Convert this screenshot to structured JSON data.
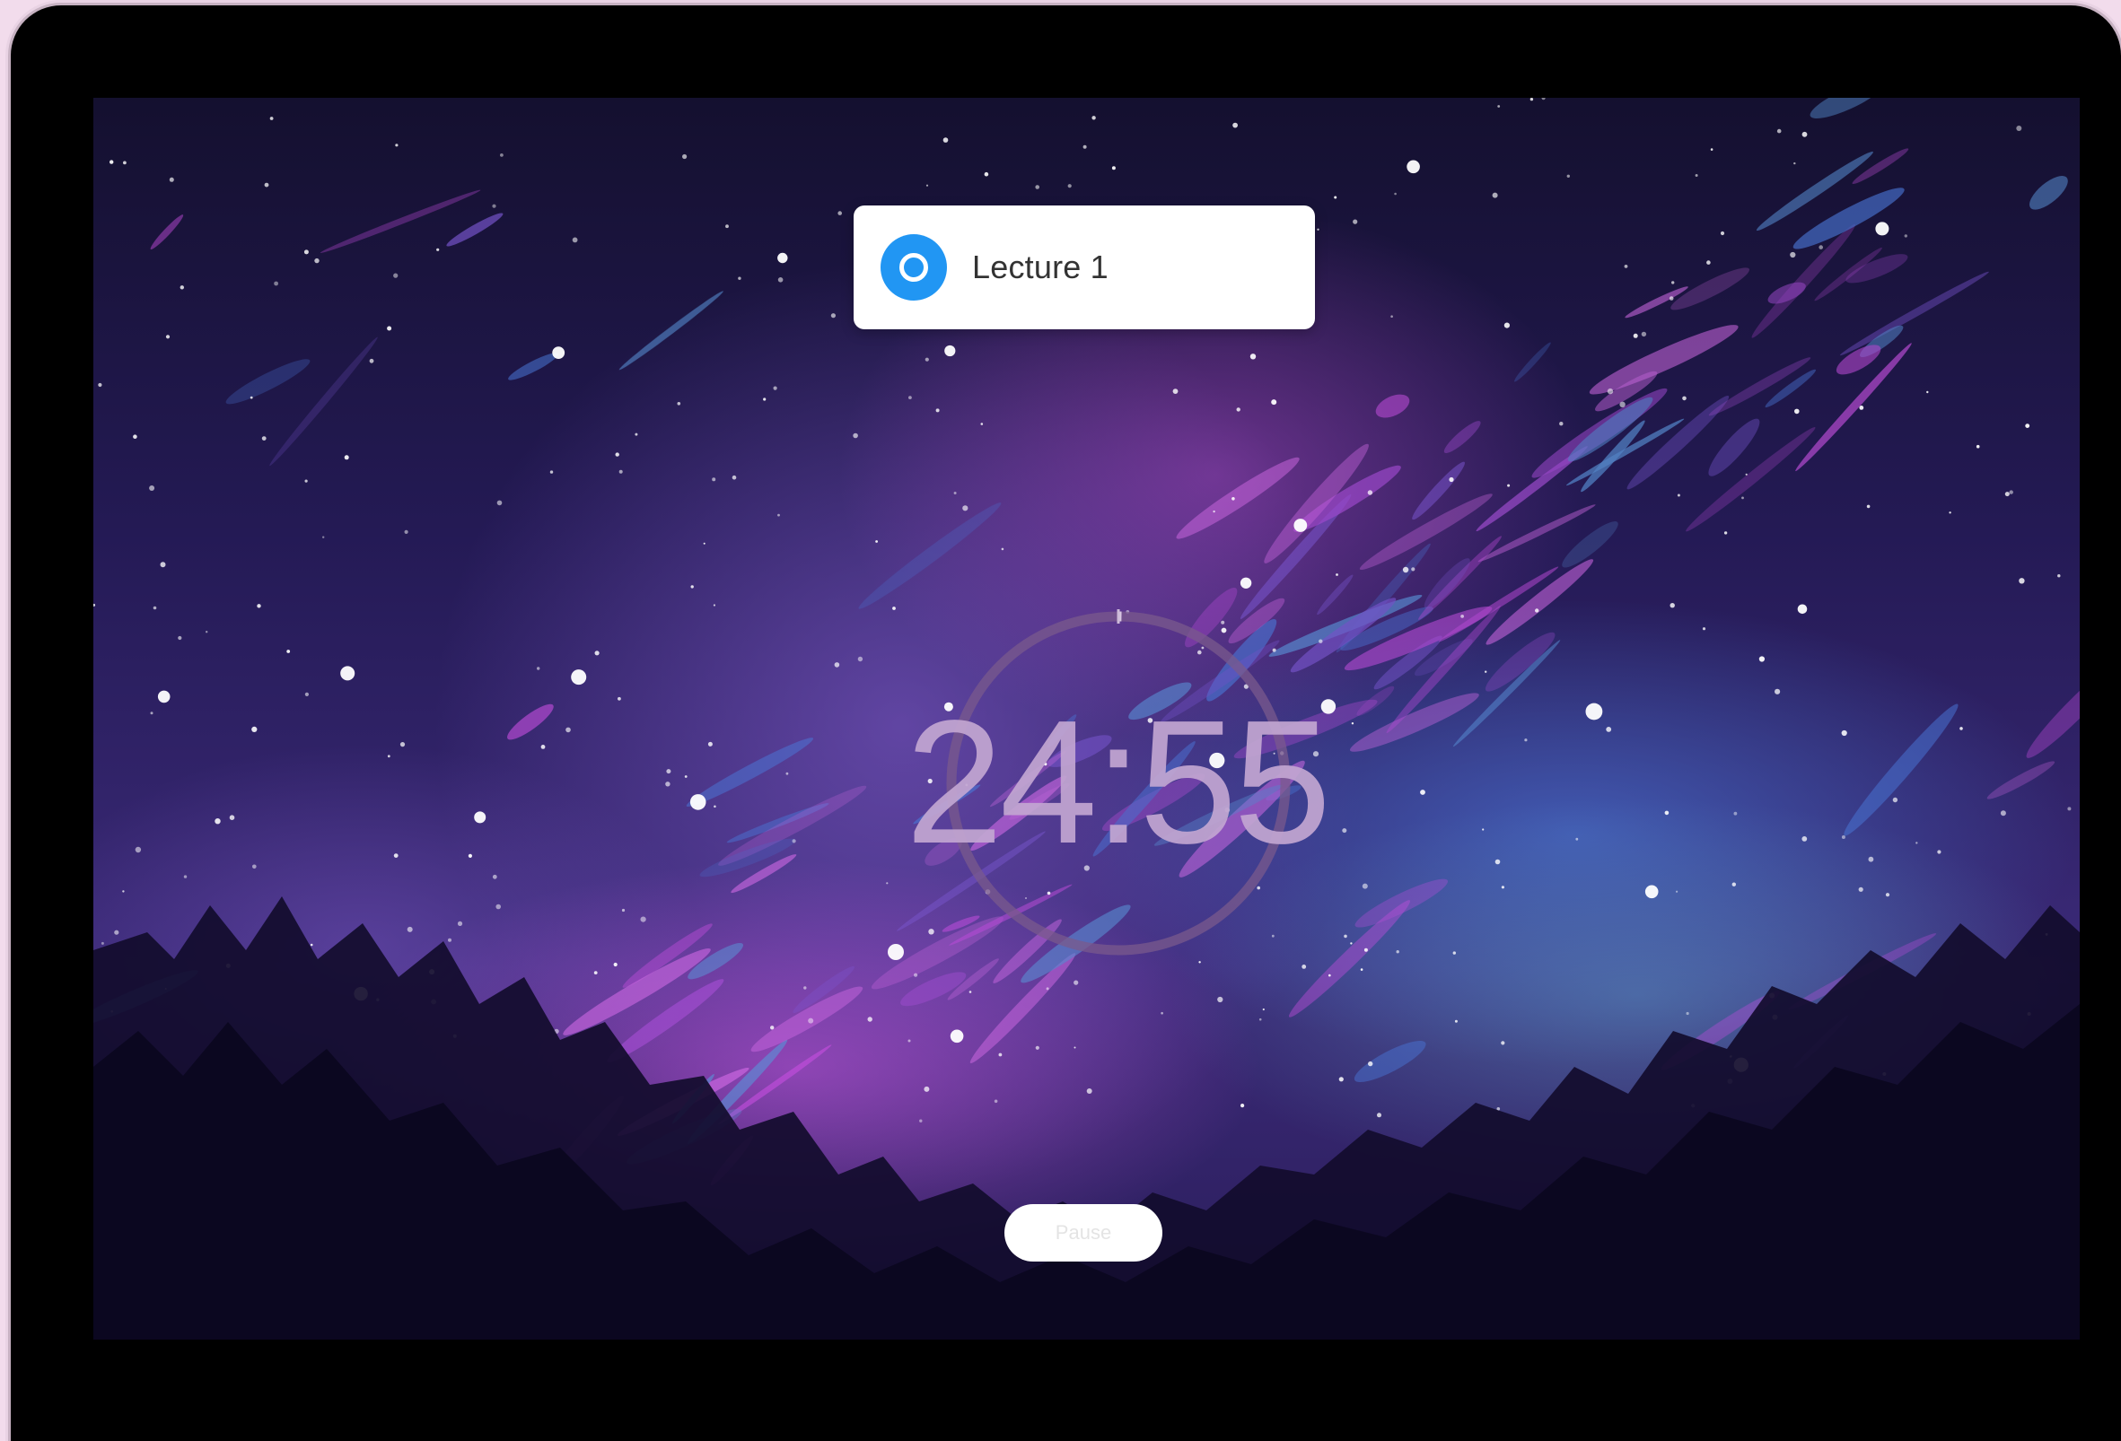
{
  "task": {
    "label": "Lecture 1",
    "check_icon": "circle-check-icon",
    "check_color": "#2196f3"
  },
  "timer": {
    "display": "24:55",
    "progress_fraction": 0.003
  },
  "controls": {
    "pause_label": "Pause"
  },
  "theme": {
    "sky_top": "#1b1444",
    "nebula_accent": "#c64fe0",
    "aurora_accent": "#3d6fd6",
    "timer_color": "#c3a6d2"
  }
}
